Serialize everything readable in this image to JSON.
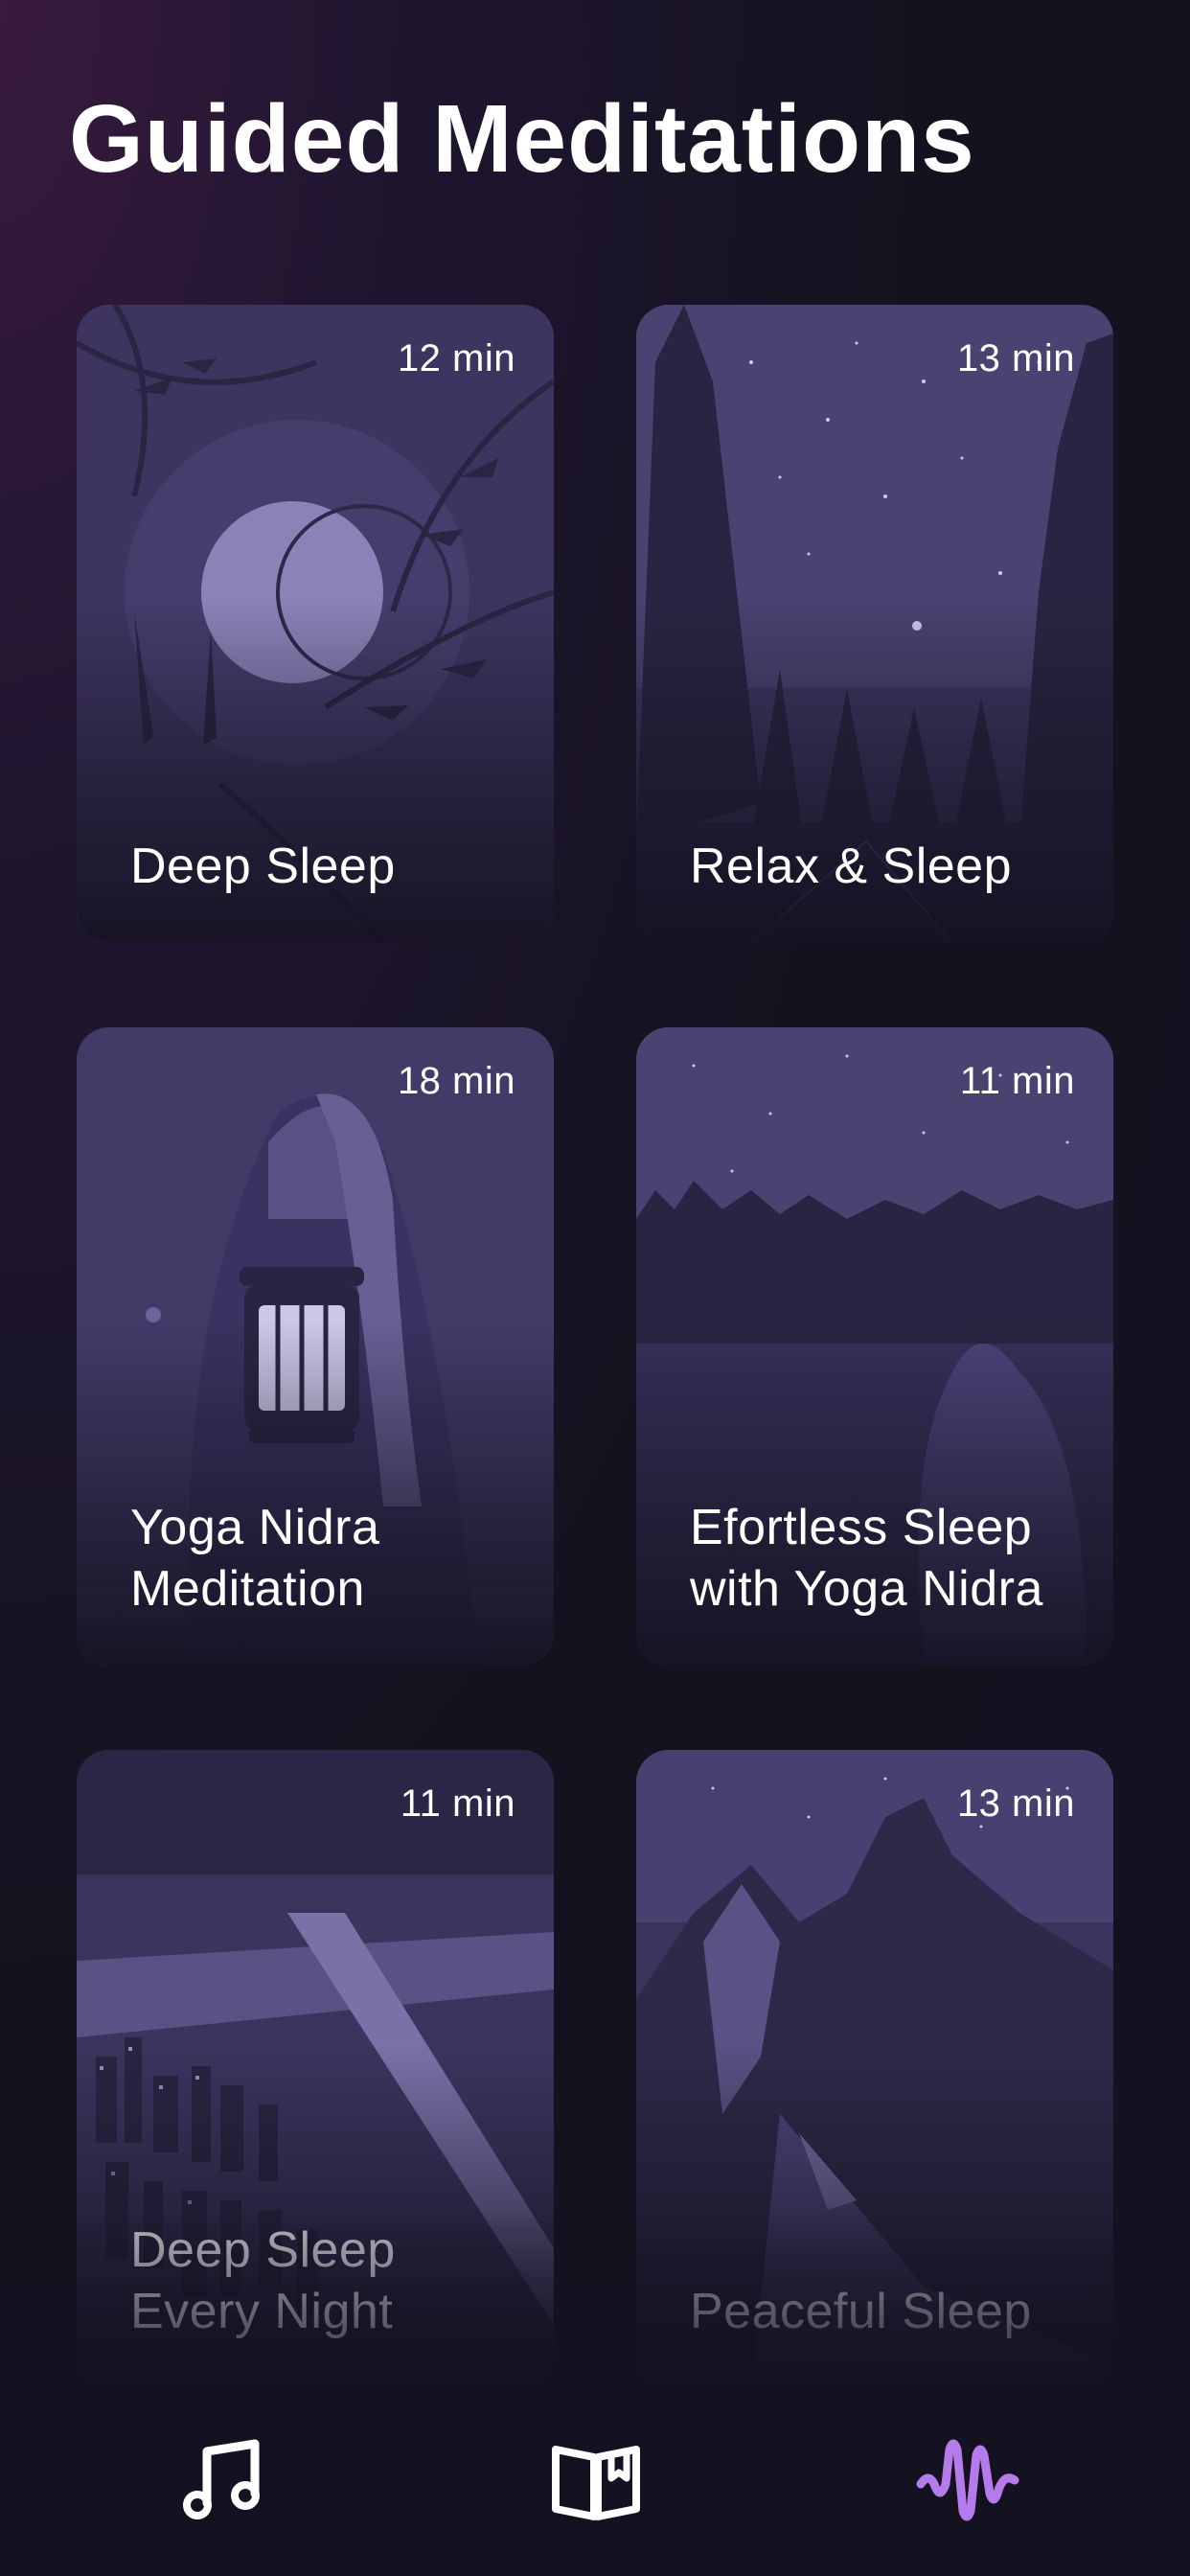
{
  "header": {
    "title": "Guided Meditations"
  },
  "cards": [
    {
      "title": "Deep Sleep",
      "duration": "12 min"
    },
    {
      "title": "Relax & Sleep",
      "duration": "13 min"
    },
    {
      "title": "Yoga Nidra Meditation",
      "duration": "18 min"
    },
    {
      "title": "Efortless Sleep with Yoga Nidra",
      "duration": "11 min"
    },
    {
      "title": "Deep Sleep Every Night",
      "duration": "11 min"
    },
    {
      "title": "Peaceful Sleep",
      "duration": "13 min"
    }
  ],
  "tabbar": {
    "items": [
      {
        "icon": "music-note-icon",
        "active": false
      },
      {
        "icon": "book-icon",
        "active": false
      },
      {
        "icon": "sound-wave-icon",
        "active": true
      }
    ],
    "active_color": "#b57bea",
    "inactive_color": "#ffffff"
  }
}
